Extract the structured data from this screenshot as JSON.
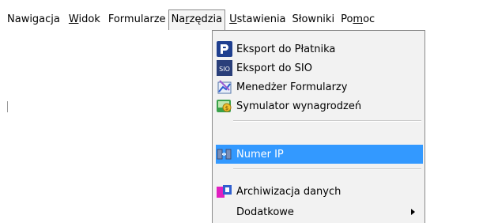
{
  "menubar": {
    "items": [
      {
        "label": "Nawigacja"
      },
      {
        "u": "W",
        "rest": "idok"
      },
      {
        "label": "Formularze"
      },
      {
        "pre": "Na",
        "u": "r",
        "rest": "zędzia"
      },
      {
        "u": "U",
        "rest": "stawienia"
      },
      {
        "label": "Słowniki"
      },
      {
        "pre": "Po",
        "u": "m",
        "rest": "oc"
      }
    ]
  },
  "dropdown": {
    "items": [
      {
        "label": "Eksport do Płatnika",
        "icon": "platnik-p-icon"
      },
      {
        "label": "Eksport do SIO",
        "icon": "sio-icon"
      },
      {
        "label": "Menedżer Formularzy",
        "icon": "form-manager-icon"
      },
      {
        "label": "Symulator wynagrodzeń",
        "icon": "salary-simulator-icon"
      },
      {
        "label": "Numer IP",
        "icon": "network-ip-icon",
        "highlighted": true
      },
      {
        "label": "Archiwizacja danych",
        "icon": "archive-icon"
      },
      {
        "label": "Dodatkowe",
        "icon": "",
        "submenu": true
      }
    ]
  },
  "colors": {
    "highlight": "#3399ff",
    "menu_bg": "#f2f2f2"
  }
}
